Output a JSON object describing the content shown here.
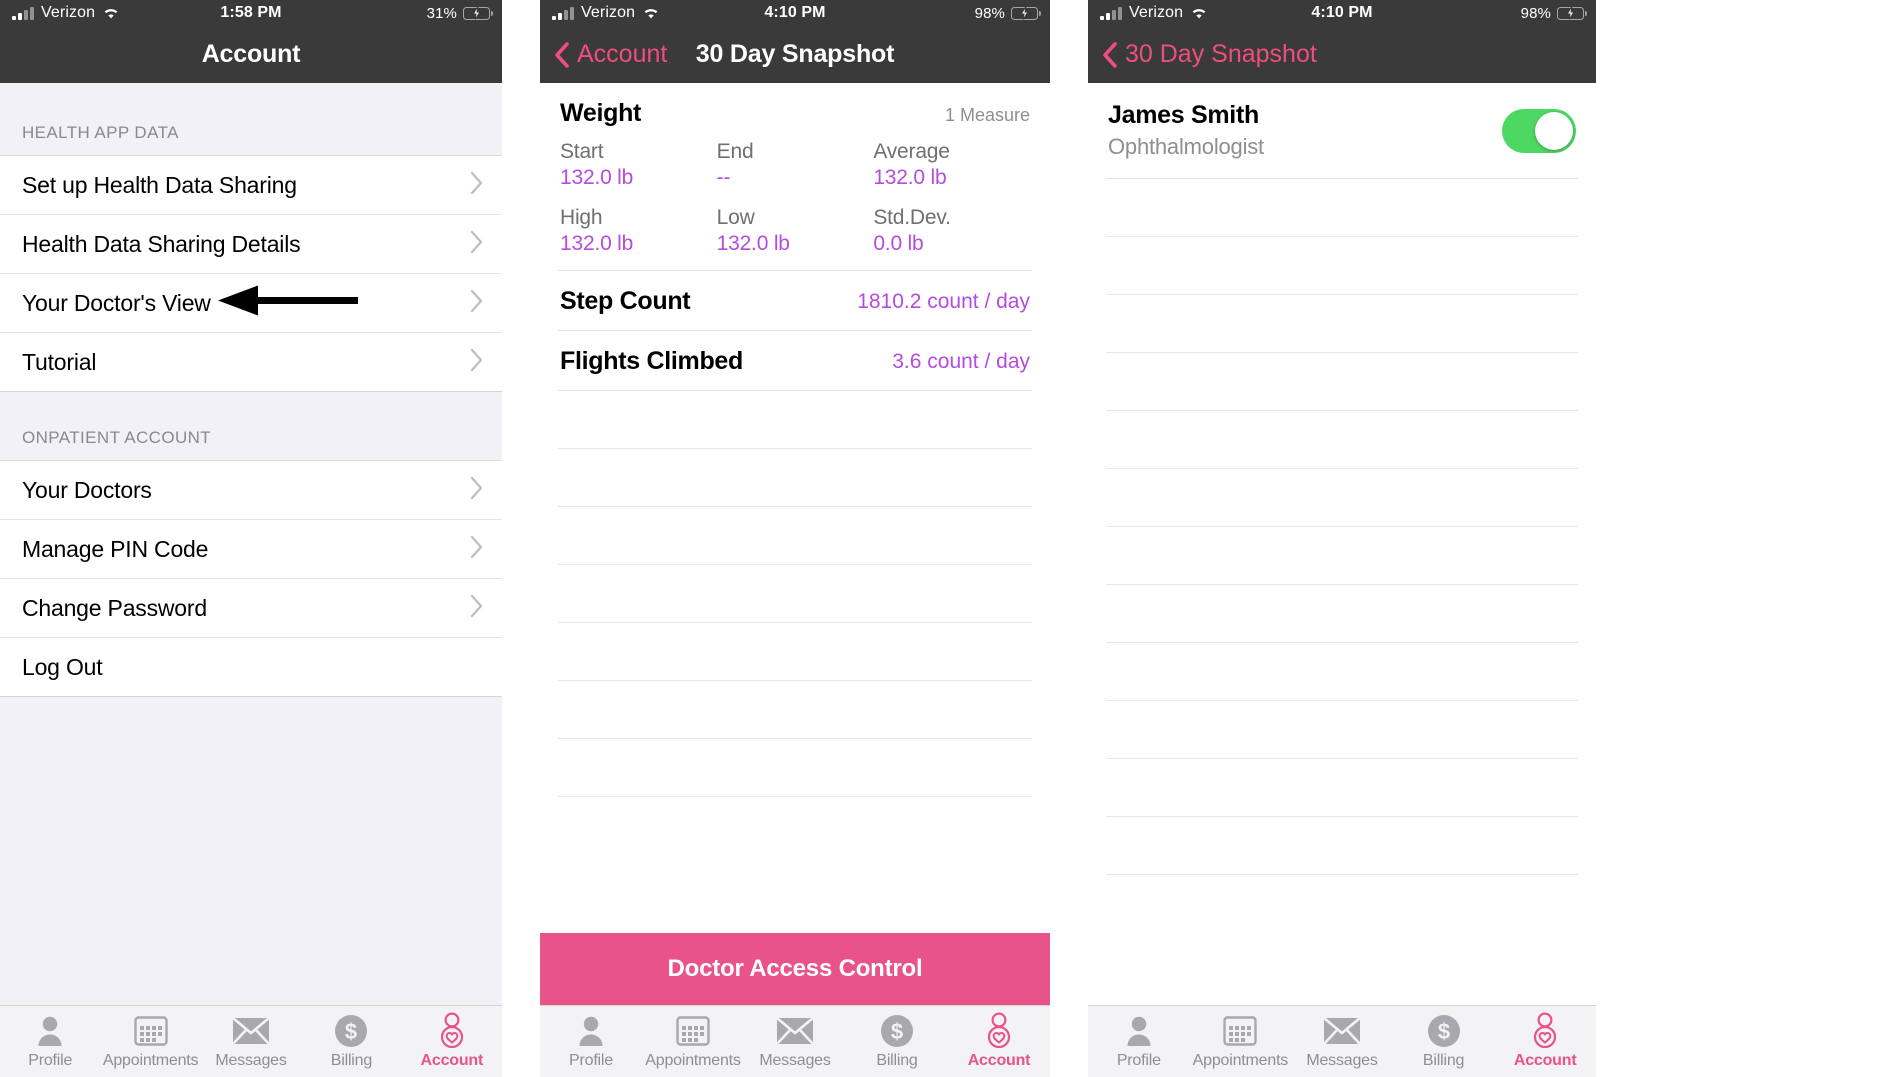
{
  "accent": {
    "pink": "#E8538A",
    "pink_nav": "#EF4D7F",
    "purple": "#B44CE0",
    "green": "#4CD863",
    "dark_bar": "#3A3A3A"
  },
  "panel1": {
    "status": {
      "carrier": "Verizon",
      "time": "1:58 PM",
      "battery_pct": "31%",
      "battery_level": 31,
      "charging": true,
      "signal_icon": "cellular-signal-icon",
      "wifi_icon": "wifi-icon",
      "battery_icon": "battery-charging-icon"
    },
    "nav": {
      "title": "Account"
    },
    "sections": [
      {
        "header": "HEALTH APP DATA",
        "items": [
          {
            "label": "Set up Health Data Sharing",
            "chevron": "chevron-right-icon",
            "annotated": false
          },
          {
            "label": "Health Data Sharing Details",
            "chevron": "chevron-right-icon",
            "annotated": false
          },
          {
            "label": "Your Doctor's View",
            "chevron": "chevron-right-icon",
            "annotated": true
          },
          {
            "label": "Tutorial",
            "chevron": "chevron-right-icon",
            "annotated": false
          }
        ]
      },
      {
        "header": "ONPATIENT ACCOUNT",
        "items": [
          {
            "label": "Your Doctors",
            "chevron": "chevron-right-icon",
            "annotated": false
          },
          {
            "label": "Manage PIN Code",
            "chevron": "chevron-right-icon",
            "annotated": false
          },
          {
            "label": "Change Password",
            "chevron": "chevron-right-icon",
            "annotated": false
          },
          {
            "label": "Log Out",
            "chevron": "",
            "annotated": false
          }
        ]
      }
    ]
  },
  "panel2": {
    "status": {
      "carrier": "Verizon",
      "time": "4:10 PM",
      "battery_pct": "98%",
      "battery_level": 98,
      "charging": true
    },
    "nav": {
      "back_label": "Account",
      "back_icon": "chevron-left-icon",
      "title": "30 Day Snapshot"
    },
    "weight": {
      "name": "Weight",
      "measures": "1 Measure",
      "stats": [
        {
          "label": "Start",
          "value": "132.0 lb"
        },
        {
          "label": "End",
          "value": "--"
        },
        {
          "label": "Average",
          "value": "132.0 lb"
        },
        {
          "label": "High",
          "value": "132.0 lb"
        },
        {
          "label": "Low",
          "value": "132.0 lb"
        },
        {
          "label": "Std.Dev.",
          "value": "0.0 lb"
        }
      ]
    },
    "simple_metrics": [
      {
        "name": "Step Count",
        "value": "1810.2 count / day"
      },
      {
        "name": "Flights Climbed",
        "value": "3.6 count / day"
      }
    ],
    "cta": "Doctor Access Control"
  },
  "panel3": {
    "status": {
      "carrier": "Verizon",
      "time": "4:10 PM",
      "battery_pct": "98%",
      "battery_level": 98,
      "charging": true
    },
    "nav": {
      "back_label": "30 Day Snapshot",
      "back_icon": "chevron-left-icon"
    },
    "doctor": {
      "name": "James Smith",
      "specialty": "Ophthalmologist",
      "access_enabled": true,
      "toggle_icon": "toggle-switch-on"
    }
  },
  "tabbar": {
    "items": [
      {
        "label": "Profile",
        "icon": "person-icon",
        "active": false
      },
      {
        "label": "Appointments",
        "icon": "calendar-icon",
        "active": false
      },
      {
        "label": "Messages",
        "icon": "envelope-icon",
        "active": false
      },
      {
        "label": "Billing",
        "icon": "dollar-circle-icon",
        "active": false
      },
      {
        "label": "Account",
        "icon": "person-heart-icon",
        "active": true
      }
    ]
  }
}
